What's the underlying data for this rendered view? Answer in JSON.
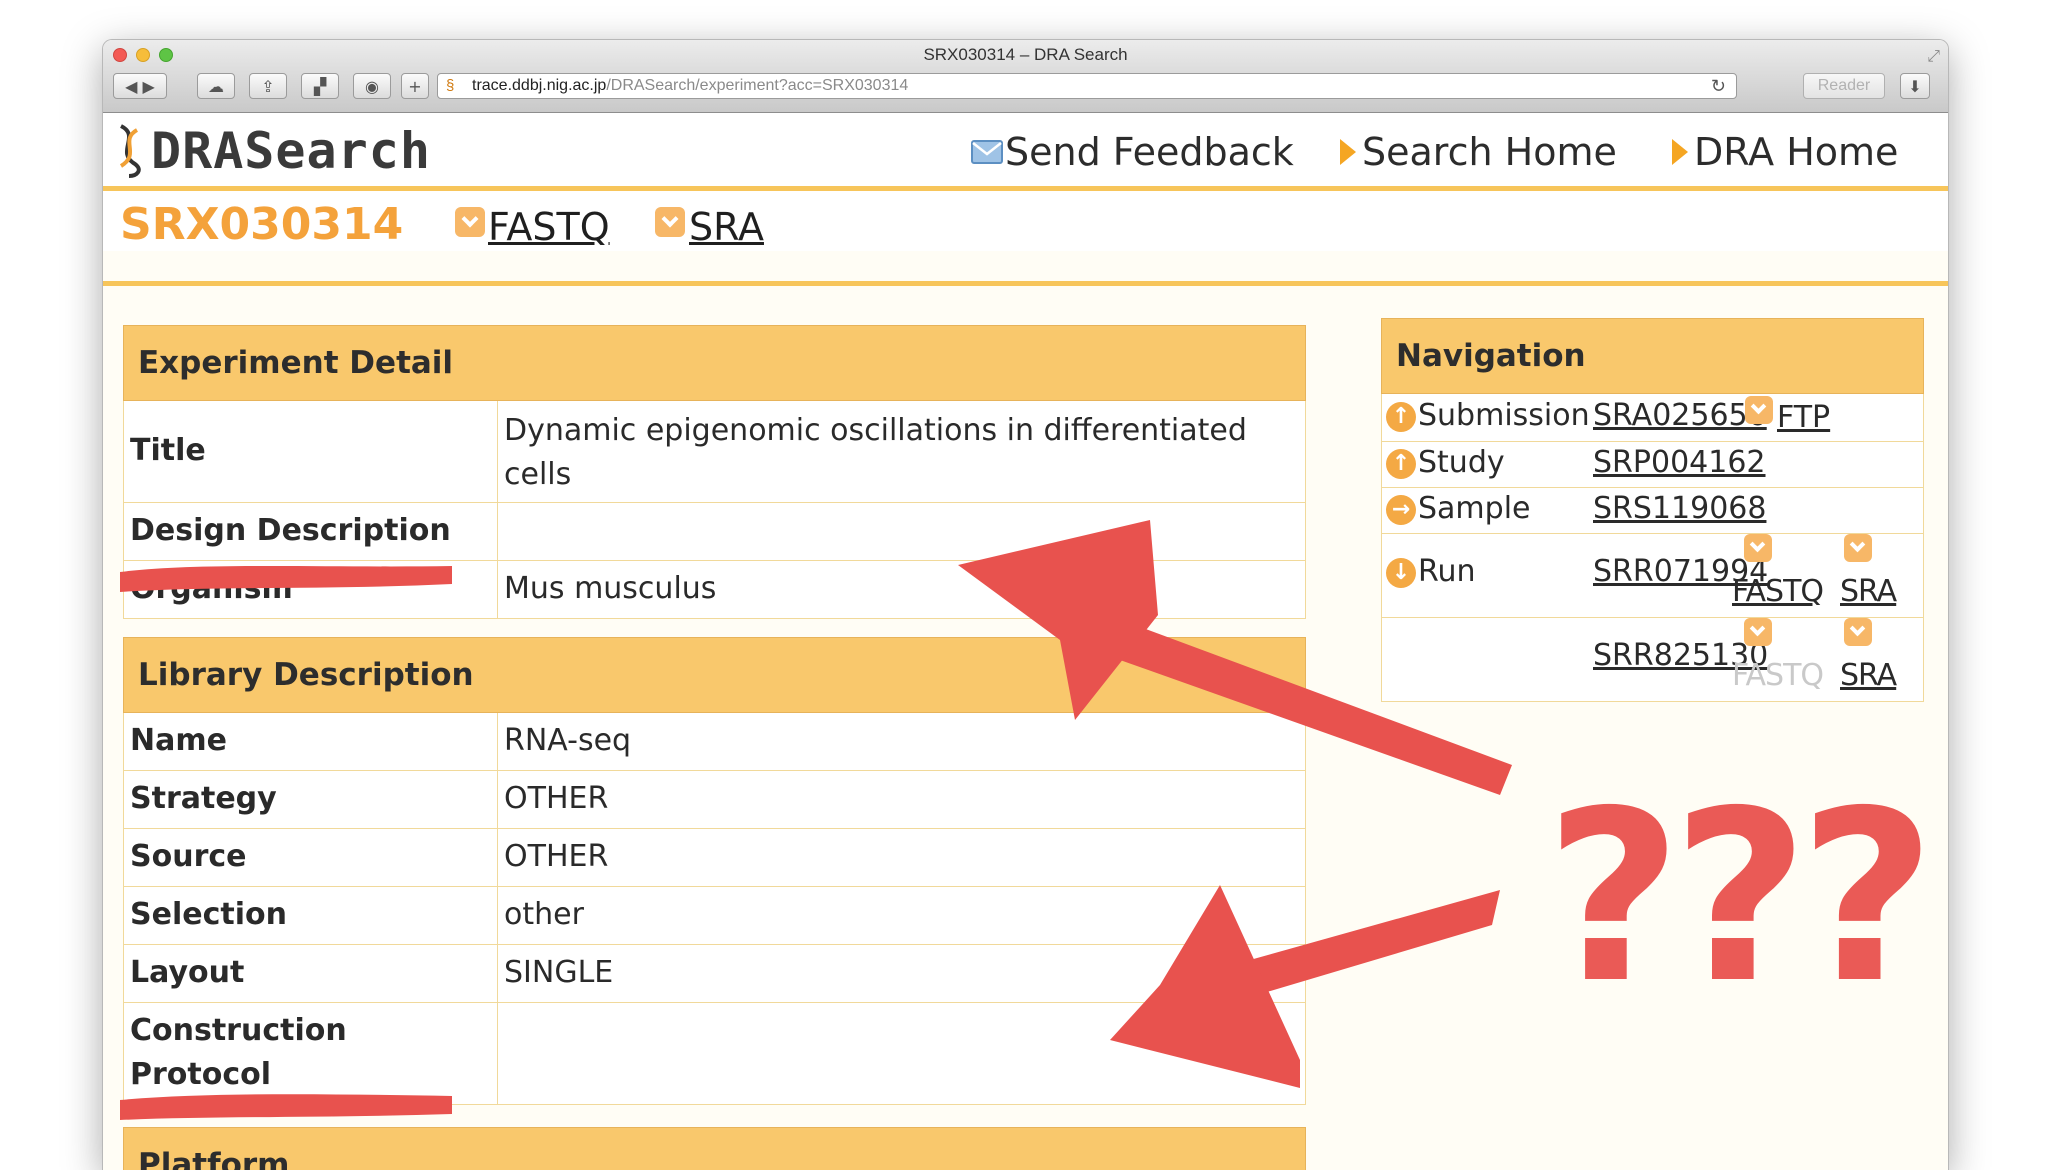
{
  "window": {
    "title": "SRX030314 – DRA Search",
    "url_host": "trace.ddbj.nig.ac.jp",
    "url_path": "/DRASearch/experiment?acc=SRX030314",
    "reader_label": "Reader"
  },
  "header": {
    "logo_text": "DRASearch",
    "nav": [
      {
        "label": "Send Feedback",
        "icon": "mail-icon"
      },
      {
        "label": "Search Home",
        "icon": "arrow-icon"
      },
      {
        "label": "DRA Home",
        "icon": "arrow-icon"
      }
    ]
  },
  "accession": {
    "id": "SRX030314",
    "links": [
      "FASTQ",
      "SRA"
    ]
  },
  "experiment_detail": {
    "heading": "Experiment Detail",
    "rows": [
      {
        "label": "Title",
        "value": "Dynamic epigenomic oscillations in differentiated cells"
      },
      {
        "label": "Design Description",
        "value": ""
      },
      {
        "label": "Organism",
        "value": "Mus musculus"
      }
    ]
  },
  "library_description": {
    "heading": "Library Description",
    "rows": [
      {
        "label": "Name",
        "value": "RNA-seq"
      },
      {
        "label": "Strategy",
        "value": "OTHER"
      },
      {
        "label": "Source",
        "value": "OTHER"
      },
      {
        "label": "Selection",
        "value": "other"
      },
      {
        "label": "Layout",
        "value": "SINGLE"
      },
      {
        "label": "Construction Protocol",
        "value": ""
      }
    ]
  },
  "platform": {
    "heading": "Platform"
  },
  "navigation": {
    "heading": "Navigation",
    "rows": [
      {
        "label": "Submission",
        "link": "SRA025656",
        "extra": "FTP"
      },
      {
        "label": "Study",
        "link": "SRP004162"
      },
      {
        "label": "Sample",
        "link": "SRS119068"
      },
      {
        "label": "Run",
        "link": "SRR071994",
        "fastq": "FASTQ",
        "sra": "SRA"
      },
      {
        "label": "",
        "link": "SRR825130",
        "fastq": "FASTQ",
        "sra": "SRA"
      }
    ]
  },
  "annotation": {
    "text": "???",
    "color": "#ea5a56"
  }
}
